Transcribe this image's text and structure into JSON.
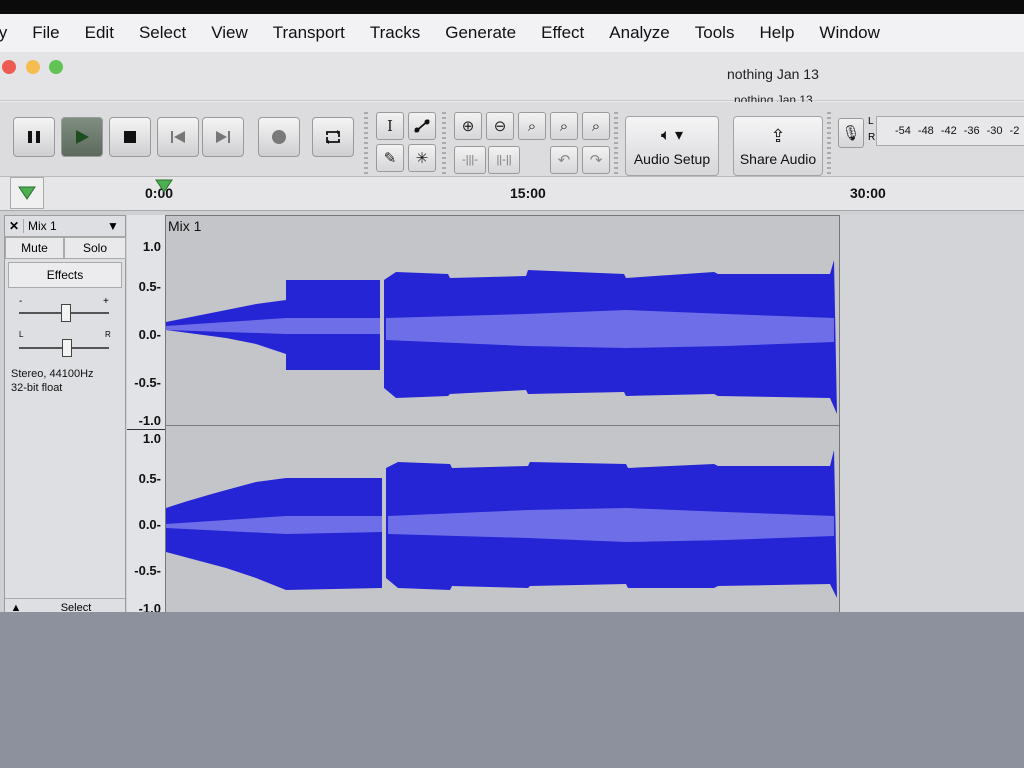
{
  "menu": [
    "ty",
    "File",
    "Edit",
    "Select",
    "View",
    "Transport",
    "Tracks",
    "Generate",
    "Effect",
    "Analyze",
    "Tools",
    "Help",
    "Window"
  ],
  "window": {
    "title_primary": "nothing Jan 13",
    "title_secondary": "nothing Jan 13"
  },
  "toolbar": {
    "audio_setup_label": "Audio Setup",
    "share_audio_label": "Share Audio",
    "meter_ticks": [
      "-54",
      "-48",
      "-42",
      "-36",
      "-30",
      "-2"
    ],
    "meter_L": "L",
    "meter_R": "R"
  },
  "timeline": {
    "labels": [
      "0:00",
      "15:00",
      "30:00"
    ]
  },
  "track": {
    "name": "Mix 1",
    "clip_name": "Mix 1",
    "mute_label": "Mute",
    "solo_label": "Solo",
    "effects_label": "Effects",
    "gain_min": "-",
    "gain_max": "+",
    "pan_left": "L",
    "pan_right": "R",
    "info_line1": "Stereo, 44100Hz",
    "info_line2": "32-bit float",
    "select_label": "Select",
    "scale_ch1": [
      "1.0",
      "0.5-",
      "0.0-",
      "-0.5-",
      "-1.0"
    ],
    "scale_ch2": [
      "1.0",
      "0.5-",
      "0.0-",
      "-0.5-",
      "-1.0"
    ]
  },
  "colors": {
    "waveform": "#2525d6",
    "waveform_rms": "#6e6ee8",
    "clip_bg": "#c4c5c9"
  }
}
